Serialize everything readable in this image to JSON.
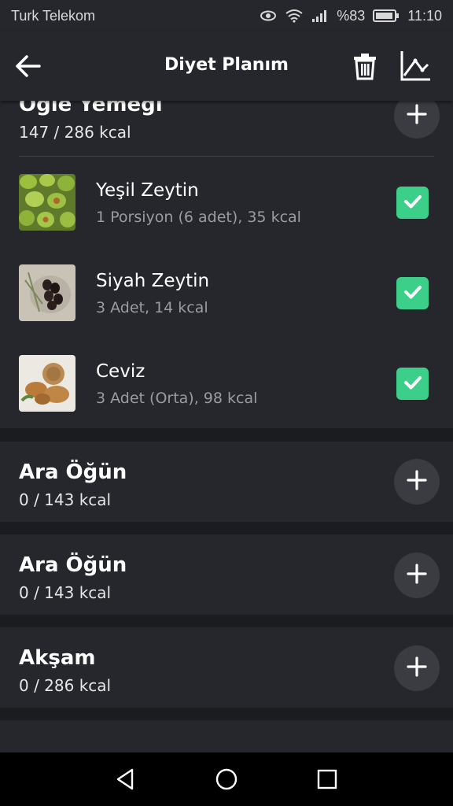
{
  "status": {
    "carrier": "Turk Telekom",
    "battery": "%83",
    "time": "11:10"
  },
  "appbar": {
    "title": "Diyet Planım",
    "icons": [
      "back-arrow-icon",
      "trash-icon",
      "chart-icon"
    ]
  },
  "meals": [
    {
      "title": "Öğle Yemeği",
      "kcal": "147 / 286 kcal",
      "items": [
        {
          "name": "Yeşil Zeytin",
          "desc": "1 Porsiyon (6 adet), 35 kcal",
          "checked": true
        },
        {
          "name": "Siyah Zeytin",
          "desc": "3 Adet, 14 kcal",
          "checked": true
        },
        {
          "name": "Ceviz",
          "desc": "3 Adet (Orta), 98 kcal",
          "checked": true
        }
      ]
    },
    {
      "title": "Ara Öğün",
      "kcal": "0 / 143 kcal",
      "items": []
    },
    {
      "title": "Ara Öğün",
      "kcal": "0 / 143 kcal",
      "items": []
    },
    {
      "title": "Akşam",
      "kcal": "0 / 286 kcal",
      "items": []
    }
  ],
  "colors": {
    "background": "#1a1c20",
    "card": "#25272c",
    "check": "#3ccf8a",
    "add_button": "#3a3c41"
  }
}
